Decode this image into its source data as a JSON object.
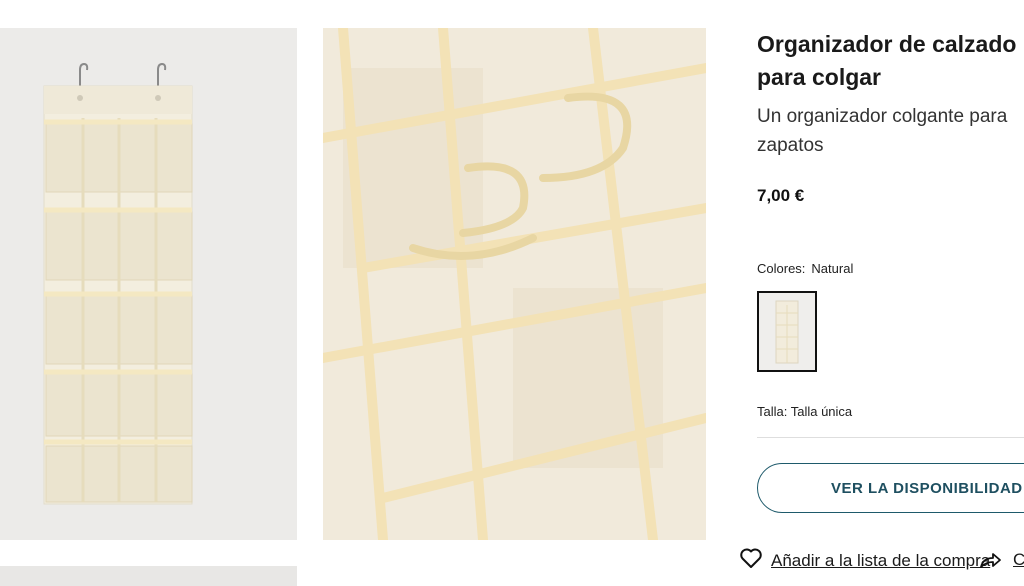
{
  "product": {
    "title_line1": "Organizador de calzado",
    "title_line2": "para colgar",
    "description_line1": "Un organizador colgante para",
    "description_line2": "zapatos",
    "price": "7,00 €"
  },
  "colors": {
    "label": "Colores:",
    "selected": "Natural"
  },
  "size": {
    "label": "Talla: Talla única"
  },
  "actions": {
    "availability_button": "VER LA DISPONIBILIDAD",
    "wishlist_link": "Añadir a la lista de la compra",
    "cut_link": "C"
  },
  "icons": {
    "wishlist": "heart-outline-icon",
    "share": "share-arrow-icon"
  },
  "theme": {
    "accent": "#1e5a6b",
    "fabric": "#f3ecd9"
  }
}
